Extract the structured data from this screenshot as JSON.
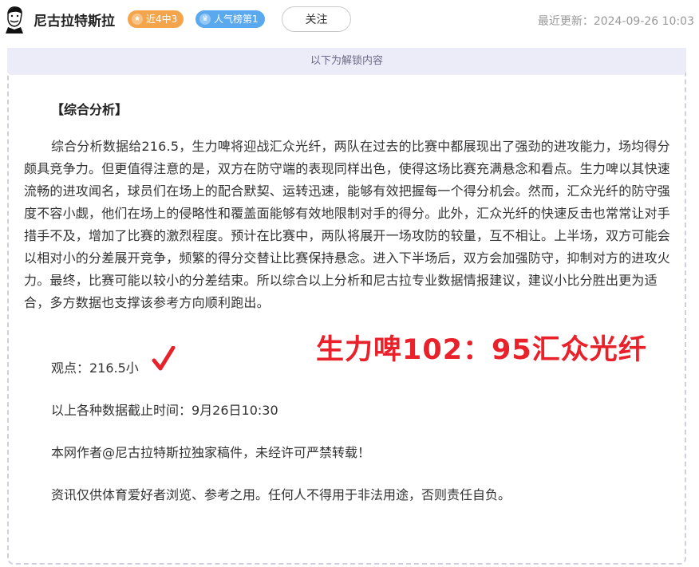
{
  "header": {
    "author_name": "尼古拉特斯拉",
    "badge_recent": "近4中3",
    "badge_rank": "人气榜第1",
    "follow_label": "关注",
    "update_label": "最近更新：",
    "update_time": "2024-09-26 10:03",
    "icons": {
      "avatar": "tesla-avatar",
      "badge_recent": "star-icon",
      "badge_rank": "crown-icon"
    },
    "colors": {
      "badge_recent": "#f4a44a",
      "badge_rank": "#5aa9ef"
    }
  },
  "unlock_banner": "以下为解锁内容",
  "article": {
    "section_title": "【综合分析】",
    "body": "综合分析数据给216.5，生力啤将迎战汇众光纤，两队在过去的比赛中都展现出了强劲的进攻能力，场均得分颇具竞争力。但更值得注意的是，双方在防守端的表现同样出色，使得这场比赛充满悬念和看点。生力啤以其快速流畅的进攻闻名，球员们在场上的配合默契、运转迅速，能够有效把握每一个得分机会。然而，汇众光纤的防守强度不容小觑，他们在场上的侵略性和覆盖面能够有效地限制对手的得分。此外，汇众光纤的快速反击也常常让对手措手不及，增加了比赛的激烈程度。预计在比赛中，两队将展开一场攻防的较量，互不相让。上半场，双方可能会以相对小的分差展开竞争，频繁的得分交替让比赛保持悬念。进入下半场后，双方会加强防守，抑制对方的进攻火力。最终，比赛可能以较小的分差结束。所以综合以上分析和尼古拉专业数据情报建议，建议小比分胜出更为适合，多方数据也支撑该参考方向顺利跑出。",
    "viewpoint": "观点：216.5小",
    "score_overlay": "生力啤102：95汇众光纤",
    "deadline": "以上各种数据截止时间：9月26日10:30",
    "copyright": "本网作者@尼古拉特斯拉独家稿件，未经许可严禁转载！",
    "disclaimer": "资讯仅供体育爱好者浏览、参考之用。任何人不得用于非法用途，否则责任自负。",
    "check_icon": "red-checkmark-icon",
    "score_color": "#e8212a"
  }
}
